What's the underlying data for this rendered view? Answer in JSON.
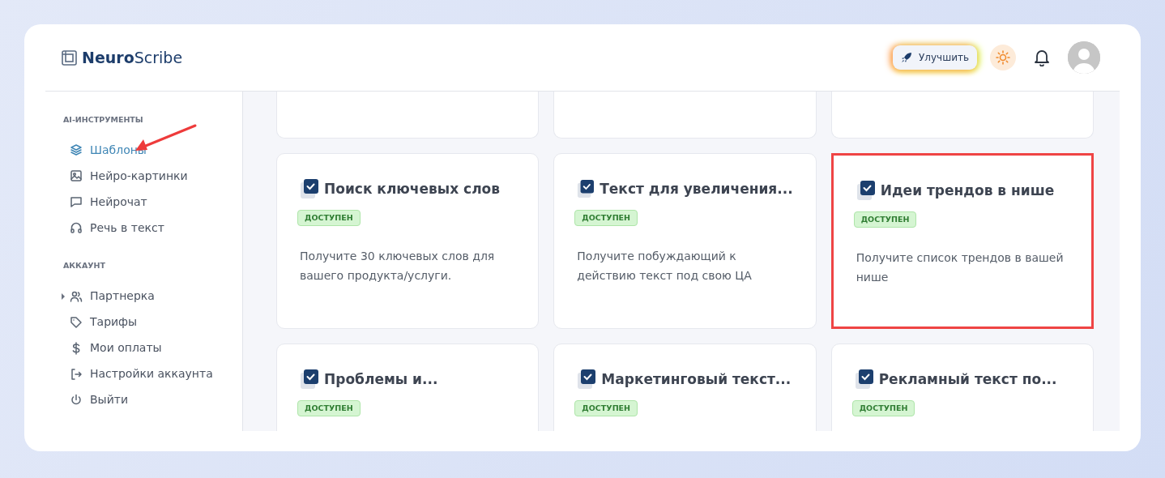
{
  "header": {
    "logo": "**Neuro**Scribe",
    "upgrade_button": "Улучшить"
  },
  "sidebar": {
    "sections": [
      {
        "title": "AI-ИНСТРУМЕНТЫ",
        "items": [
          {
            "label": "Шаблоны",
            "selected": true,
            "annotated": true
          },
          {
            "label": "Нейро-картинки",
            "selected": false,
            "annotated": false
          },
          {
            "label": "Нейрочат",
            "selected": false,
            "annotated": false
          },
          {
            "label": "Речь в текст",
            "selected": false,
            "annotated": false
          }
        ]
      },
      {
        "title": "АККАУНТ",
        "items": [
          {
            "label": "Партнерка",
            "selected": false,
            "annotated": false,
            "expanded": false
          },
          {
            "label": "Тарифы",
            "selected": false,
            "annotated": false
          },
          {
            "label": "Мои оплаты",
            "selected": false,
            "annotated": false
          },
          {
            "label": "Настройки аккаунта",
            "selected": false,
            "annotated": false
          },
          {
            "label": "Выйти",
            "selected": false,
            "annotated": false
          }
        ]
      }
    ]
  },
  "cards": [
    {
      "title": "Поиск ключевых слов",
      "badge": "ДОСТУПЕН",
      "description": "Получите 30 ключевых слов для вашего продукта/услуги.",
      "highlighted": false
    },
    {
      "title": "Текст для увеличения...",
      "badge": "ДОСТУПЕН",
      "description": "Получите побуждающий к действию текст под свою ЦА",
      "highlighted": false
    },
    {
      "title": "Идеи трендов в нише",
      "badge": "ДОСТУПЕН",
      "description": "Получите список трендов в вашей нише",
      "highlighted": true
    },
    {
      "title": "Проблемы и...",
      "badge": "ДОСТУПЕН",
      "highlighted": false
    },
    {
      "title": "Маркетинговый текст...",
      "badge": "ДОСТУПЕН",
      "highlighted": false
    },
    {
      "title": "Рекламный текст по...",
      "badge": "ДОСТУПЕН",
      "highlighted": false
    }
  ]
}
